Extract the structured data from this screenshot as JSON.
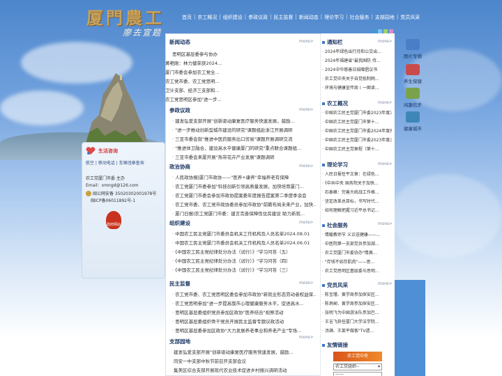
{
  "header": {
    "logo_title": "厦門農工",
    "logo_sign": "廖去宣题",
    "nav": [
      "首页",
      "农工概况",
      "组织建设",
      "参政议政",
      "民主监督",
      "新闻动态",
      "理论学习",
      "社会服务",
      "支部园地",
      "党员风采"
    ],
    "color_dots": [
      "#3e9ad6",
      "#7ec5e8",
      "#9ad36b",
      "#d88ac7"
    ]
  },
  "news": {
    "title": "新闻动态",
    "more": "more>",
    "items": [
      "思明区基层委参与协办",
      "黄艳刚：林力健荣获2024...",
      "厦门市委会参加农工党全...",
      "农工党市委、农工党思明...",
      "卫计支部、经济三支部和...",
      "农工党思明区参加\"进一步..."
    ]
  },
  "canzheng": {
    "title": "参政议政",
    "more": "more>",
    "items": [
      "建发弘爱支部开展\"创新驱动康复医疗服务快速发展，鼓励...",
      "\"进一步推动创新型城市建设的研究\"课题组赴浙江开展调研",
      "三亚市委会就\"推进中医药服务出口贸易\"课题开展调研交流",
      "\"推进体卫融合，建设高水平健康厦门的研究\"重点联合课题组...",
      "三亚市委会来厦开展\"热带花卉产业发展\"课题调研"
    ]
  },
  "zhengzhi": {
    "title": "政治协商",
    "more": "more>",
    "items": [
      "人民政协报|厦门市政协——\"医养+康养\"幸福养老有保障",
      "农工党厦门市委参加\"科技创新引领高质量发展，加快培育厦门...",
      "农工党厦门市委会参加市政协提案委年度报告提案第二季度季谈会",
      "农工党市委、农工党市政协委员参加市政协\"前瞻布局未来产业，加快...",
      "厦门日报|农工党厦门市委：建言完善保障性住房建设 助力新就..."
    ]
  },
  "zuzhi": {
    "title": "组织建设",
    "more": "more>",
    "items": [
      "中国农工民主党厦门市委员会机关工作机构及人员名单2024.08.01",
      "中国农工民主党厦门市委员会机关工作机构及人员名单2024.06.01",
      "《中国农工民主党纪律处分办法（试行）》\"学习问答（五）",
      "《中国农工民主党纪律处分办法（试行）》\"学习问答（四）",
      "《中国农工民主党纪律处分办法（试行）》\"学习问答（三）"
    ]
  },
  "jiandu": {
    "title": "民主监督",
    "more": "more>",
    "items": [
      "农工党市委、农工党思明区委会参加市政协\"新就业形态劳动者权益保...",
      "农工党思明参加\"进一步提高我市心理健康服务水平，促进高水...",
      "思明区基层委组织党员参加区政协\"医养结合\"视察活动",
      "思明区基层委组织骨干党员开展民主监督专题议政活动",
      "思明区基层委参加区政协\"大力发展养老事业和养老产业\"专场..."
    ]
  },
  "zhibu": {
    "title": "支部园地",
    "more": "more>",
    "items": [
      "建发弘爱支部开展\"创新驱动康复医疗服务快速发展，鼓励...",
      "同安一中支部中秋节前召开支部会议",
      "集美区综合支部开展现代农业技术促进乡村振兴调研活动"
    ]
  },
  "tongzhi": {
    "title": "通知栏",
    "more": "more>",
    "items": [
      "2024年绿色出行月和公交出...",
      "2024年福建省\"最我国防 侍...",
      "2024中华慈善日捐赠倡议书",
      "农工党中央关于自觉抵制网...",
      "环境与健康宣传周丨一图读..."
    ]
  },
  "gaikuang": {
    "title": "农工概况",
    "more": "more>",
    "items": [
      "中国农工民主党厦门市委2023年度决...",
      "中国农工民主党厦门市第十...",
      "中国农工民主党厦门市委2024年度预...",
      "中国农工民主党厦门市委2023年度决...",
      "中国农工民主党章程（第十..."
    ]
  },
  "lilun": {
    "title": "理论学习",
    "more": "more>",
    "items": [
      "人民日报任平文章：在绿色...",
      "《中共中央 国务院关于加快...",
      "石泰峰：完善大统战工作格...",
      "坚定改革总目标，书写时代...",
      "如何理解把握习近平总书记..."
    ]
  },
  "shehui": {
    "title": "社会服务",
    "more": "more>",
    "items": [
      "情暖教师节 义诊送健康——...",
      "中医院第一支部党员参加湖...",
      "农工党厦门市委协办\"情满...",
      "\"存钱不如存肌肉\"——思...",
      "农工党思明区基层委与思明..."
    ]
  },
  "dangyuan": {
    "title": "党员风采",
    "more": "more>",
    "items": [
      "陈宝瑾、黄学周参加探安区...",
      "陈炳昶、黄学周参加探安区...",
      "张明飞为中国游泳队参加巴...",
      "王吉飞获任厦门大学法学院...",
      "汤满、王莱平做客\"TV透..."
    ]
  },
  "youqing": {
    "title": "友情链接",
    "banner": "农工党中央",
    "select1": "农工党组织--",
    "select2": "——"
  },
  "leftbox": {
    "title": "生活咨询",
    "links": "航空 | 移动电话 | 车辆违章查询",
    "host": "农工党厦门市委 主办",
    "email": "Email：xmngd@126.com",
    "beian1": "闽公网安备 35020302001978号",
    "beian2": "闽ICP备06011892号-1",
    "badge": "政府网站"
  },
  "right_icons": [
    {
      "label": "图片专辑",
      "color": "#4a7fc8"
    },
    {
      "label": "养生保健",
      "color": "#c94c4c"
    },
    {
      "label": "闲趣信步",
      "color": "#7aa24c"
    },
    {
      "label": "健康城市",
      "color": "#3f86b8"
    }
  ]
}
